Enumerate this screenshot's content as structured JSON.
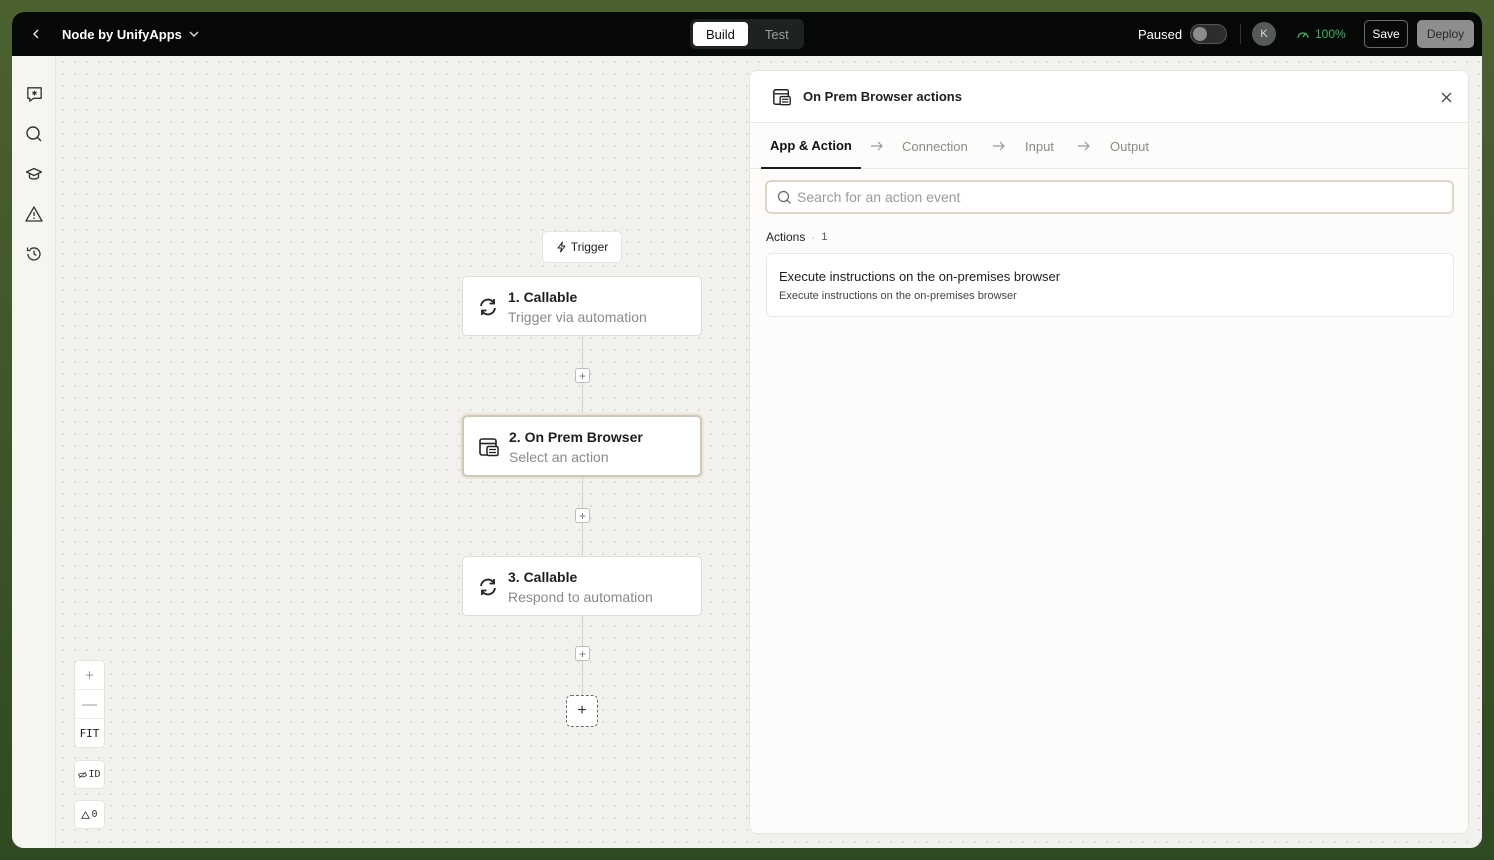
{
  "header": {
    "app_title": "Node by UnifyApps",
    "modes": [
      "Build",
      "Test"
    ],
    "active_mode": "Build",
    "status_label": "Paused",
    "avatar_initial": "K",
    "health_percent": "100%",
    "save_label": "Save",
    "deploy_label": "Deploy"
  },
  "rail": {
    "icons": [
      "ai-assistant-icon",
      "search-icon",
      "learn-icon",
      "warning-icon",
      "history-icon"
    ]
  },
  "canvas": {
    "trigger_label": "Trigger",
    "nodes": [
      {
        "title": "1. Callable",
        "subtitle": "Trigger via automation",
        "icon": "sync-icon"
      },
      {
        "title": "2. On Prem Browser",
        "subtitle": "Select an action",
        "icon": "browser-icon"
      },
      {
        "title": "3. Callable",
        "subtitle": "Respond to automation",
        "icon": "sync-icon"
      }
    ],
    "zoom": {
      "in": "+",
      "out": "—",
      "fit": "FIT"
    },
    "id_toggle_label": "ID",
    "warnings_count": "0"
  },
  "panel": {
    "title": "On Prem Browser actions",
    "tabs": [
      "App & Action",
      "Connection",
      "Input",
      "Output"
    ],
    "active_tab": "App & Action",
    "search_placeholder": "Search for an action event",
    "actions_heading": "Actions",
    "actions_count": "1",
    "actions": [
      {
        "title": "Execute instructions on the on-premises browser",
        "description": "Execute instructions on the on-premises browser"
      }
    ]
  },
  "colors": {
    "topbar_bg": "#060906",
    "health_green": "#3bb36a",
    "selected_border": "#cfc7ba"
  }
}
